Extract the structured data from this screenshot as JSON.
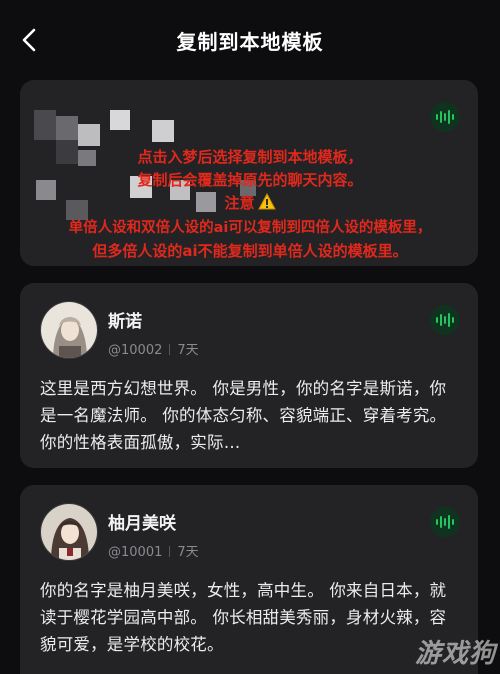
{
  "header": {
    "title": "复制到本地模板",
    "back_icon": "chevron-left-icon"
  },
  "notice": {
    "line1": "点击入梦后选择复制到本地模板，",
    "line2": "复制后会覆盖掉原先的聊天内容。",
    "line3": "注意",
    "line4": "单倍人设和双倍人设的ai可以复制到四倍人设的模板里，",
    "line5": "但多倍人设的ai不能复制到单倍人设的模板里。",
    "color": "#e0281c",
    "warning_icon": "warning-icon"
  },
  "accent_color": "#22c55e",
  "cards": [
    {
      "name": "斯诺",
      "id": "@10002",
      "time": "7天",
      "desc": "这里是西方幻想世界。 你是男性，你的名字是斯诺，你是一名魔法师。 你的体态匀称、容貌端正、穿着考究。 你的性格表面孤傲，实际…"
    },
    {
      "name": "柚月美咲",
      "id": "@10001",
      "time": "7天",
      "desc": "你的名字是柚月美咲，女性，高中生。 你来自日本，就读于樱花学园高中部。 你长相甜美秀丽，身材火辣，容貌可爱，是学校的校花。"
    }
  ],
  "watermark": "游戏狗"
}
